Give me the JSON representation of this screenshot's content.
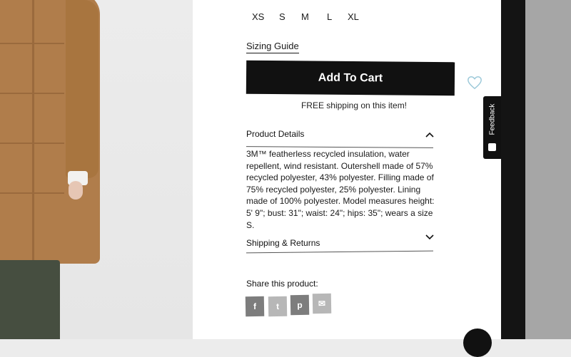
{
  "sizes": [
    "XS",
    "S",
    "M",
    "L",
    "XL"
  ],
  "sizing_guide": "Sizing Guide",
  "cart": {
    "add_label": "Add To Cart",
    "shipping_note": "FREE shipping on this item!"
  },
  "details": {
    "title": "Product Details",
    "body": "3M™ featherless recycled insulation, water repellent, wind resistant. Outershell made of 57% recycled polyester, 43% polyester. Filling made of 75% recycled polyester, 25% polyester. Lining made of 100% polyester. Model measures height: 5' 9\"; bust: 31\"; waist: 24\"; hips: 35\"; wears a size S."
  },
  "shipping_returns": {
    "title": "Shipping & Returns"
  },
  "share": {
    "label": "Share this product:",
    "buttons": [
      {
        "icon": "facebook-icon",
        "glyph": "f",
        "color": "#7d7d7d"
      },
      {
        "icon": "twitter-icon",
        "glyph": "t",
        "color": "#b7b7b7"
      },
      {
        "icon": "pinterest-icon",
        "glyph": "p",
        "color": "#7d7d7d"
      },
      {
        "icon": "email-icon",
        "glyph": "✉",
        "color": "#b7b7b7"
      }
    ]
  },
  "feedback": {
    "label": "Feedback"
  },
  "colors": {
    "accent": "#111111",
    "heart": "#9cc9d9",
    "coat": "#b07d4b"
  }
}
